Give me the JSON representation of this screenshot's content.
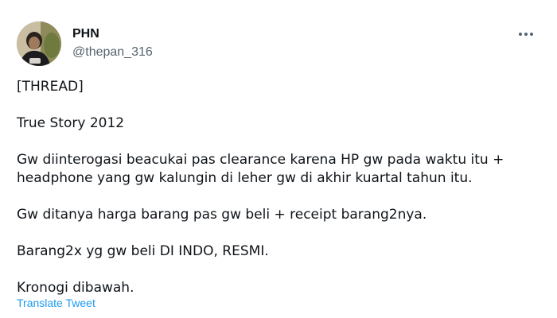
{
  "author": {
    "display_name": "PHN",
    "handle": "@thepan_316",
    "avatar_icon": "profile-photo"
  },
  "menu": {
    "more_icon": "more-horizontal-icon"
  },
  "tweet": {
    "paragraphs": [
      "[THREAD]",
      "True Story 2012",
      "Gw diinterogasi beacukai pas clearance karena HP gw pada waktu itu + headphone yang gw kalungin di leher gw di akhir kuartal tahun itu.",
      "Gw ditanya harga barang pas gw beli + receipt barang2nya.",
      "Barang2x yg gw beli DI INDO, RESMI.",
      "Kronogi dibawah."
    ]
  },
  "actions": {
    "translate_label": "Translate Tweet"
  },
  "colors": {
    "text": "#0f1419",
    "secondary": "#536471",
    "link": "#1d9bf0"
  }
}
